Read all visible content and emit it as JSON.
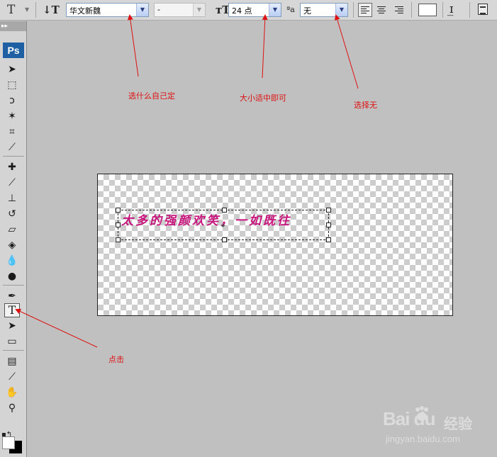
{
  "options_bar": {
    "tool_preset_icon": "type-tool-icon",
    "orientation_icon": "text-orientation-icon",
    "font_family": "华文新魏",
    "font_style": "-",
    "font_size_icon": "font-size-icon",
    "font_size": "24 点",
    "antialias_icon": "antialias-icon",
    "antialias": "无",
    "align": [
      "left",
      "center",
      "right"
    ],
    "align_active": "left",
    "text_color": "#ffffff",
    "warp_icon": "warp-text-icon",
    "palettes_icon": "character-palette-icon"
  },
  "tools_panel": {
    "header": "▸▸",
    "logo": "Ps",
    "tools": [
      {
        "name": "move-tool",
        "glyph": "➤"
      },
      {
        "name": "marquee-tool",
        "glyph": "⬚"
      },
      {
        "name": "lasso-tool",
        "glyph": "ↄ"
      },
      {
        "name": "magic-wand-tool",
        "glyph": "✶"
      },
      {
        "name": "crop-tool",
        "glyph": "⌗"
      },
      {
        "name": "slice-tool",
        "glyph": "⟋"
      },
      {
        "name": "healing-brush-tool",
        "glyph": "✚"
      },
      {
        "name": "brush-tool",
        "glyph": "⟋"
      },
      {
        "name": "clone-stamp-tool",
        "glyph": "⊥"
      },
      {
        "name": "history-brush-tool",
        "glyph": "↺"
      },
      {
        "name": "eraser-tool",
        "glyph": "▱"
      },
      {
        "name": "paint-bucket-tool",
        "glyph": "◈"
      },
      {
        "name": "blur-tool",
        "glyph": "💧"
      },
      {
        "name": "dodge-tool",
        "glyph": "●"
      },
      {
        "name": "pen-tool",
        "glyph": "✒"
      },
      {
        "name": "type-tool",
        "glyph": "T"
      },
      {
        "name": "path-selection-tool",
        "glyph": "➤"
      },
      {
        "name": "rectangle-tool",
        "glyph": "▭"
      },
      {
        "name": "notes-tool",
        "glyph": "▤"
      },
      {
        "name": "eyedropper-tool",
        "glyph": "⟋"
      },
      {
        "name": "hand-tool",
        "glyph": "✋"
      },
      {
        "name": "zoom-tool",
        "glyph": "⚲"
      }
    ],
    "selected_tool": "type-tool",
    "foreground_color": "#ffffff",
    "background_color": "#000000"
  },
  "canvas": {
    "layer_text": "太多的强颜欢笑，一如既往",
    "text_color": "#c8157d"
  },
  "annotations": {
    "font_note": "选什么自己定",
    "size_note": "大小适中即可",
    "antialias_note": "选择无",
    "tool_note": "点击"
  },
  "watermark": {
    "logo": "Bai  du",
    "label": "经验",
    "url": "jingyan.baidu.com"
  }
}
